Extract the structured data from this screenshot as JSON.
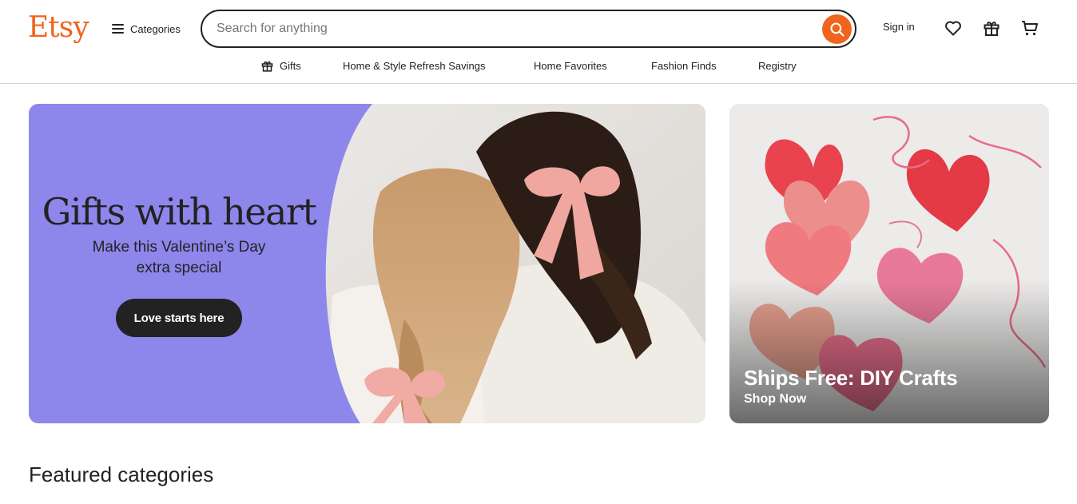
{
  "header": {
    "logo": "Etsy",
    "categories_label": "Categories",
    "search_placeholder": "Search for anything",
    "signin_label": "Sign in"
  },
  "subnav": {
    "items": [
      {
        "label": "Gifts",
        "icon": "gift-icon"
      },
      {
        "label": "Home & Style Refresh Savings"
      },
      {
        "label": "Home Favorites"
      },
      {
        "label": "Fashion Finds"
      },
      {
        "label": "Registry"
      }
    ]
  },
  "hero": {
    "title": "Gifts with heart",
    "subtitle": "Make this Valentine’s Day extra special",
    "cta": "Love starts here",
    "background_color": "#8D87EC"
  },
  "promo": {
    "title": "Ships Free: DIY Crafts",
    "cta": "Shop Now"
  },
  "section": {
    "featured_title": "Featured categories"
  },
  "colors": {
    "brand": "#F1641E",
    "text": "#222222"
  }
}
